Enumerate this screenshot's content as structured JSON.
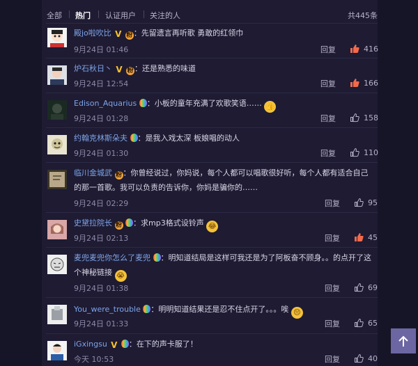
{
  "tabs": {
    "all": "全部",
    "hot": "热门",
    "verified": "认证用户",
    "following": "关注的人",
    "total": "共445条"
  },
  "reply_label": "回复",
  "comments": [
    {
      "user": "殿jo啦吹比",
      "text": "先留遗言再听歌 勇敢的红领巾",
      "time": "9月24日 01:46",
      "likes": "416",
      "liked": true
    },
    {
      "user": "炉石秋日丶",
      "text": "还是熟悉的味道",
      "time": "9月24日 12:54",
      "likes": "166",
      "liked": true
    },
    {
      "user": "Edison_Aquarius",
      "text": "小板的童年充满了欢歌笑语……",
      "time": "9月24日 01:28",
      "likes": "158",
      "liked": false
    },
    {
      "user": "约翰克林斯朵夫",
      "text": "是我入戏太深 板娘唱的动人",
      "time": "9月24日 01:30",
      "likes": "110",
      "liked": false
    },
    {
      "user": "临川金城武",
      "text": "你曾经说过，你妈说，每个人都可以唱歌很好听，每个人都有适合自己的那一首歌。我可以负责的告诉你，你妈是骗你的……",
      "time": "9月24日 02:29",
      "likes": "95",
      "liked": false
    },
    {
      "user": "史黛拉院长",
      "text": "求mp3格式设铃声",
      "time": "9月24日 02:13",
      "likes": "45",
      "liked": true
    },
    {
      "user": "麦兜麦兜你怎么了麦兜",
      "text": "明知道结局是这样可我还是为了阿板奋不顾身。。的点开了这个神秘链接",
      "time": "9月24日 01:38",
      "likes": "69",
      "liked": false
    },
    {
      "user": "You_were_trouble",
      "text": "明明知道结果还是忍不住点开了。。。唉",
      "time": "9月24日 01:33",
      "likes": "65",
      "liked": false
    },
    {
      "user": "iGxingsu",
      "text": "在下的声卡服了！",
      "time": "今天 10:53",
      "likes": "40",
      "liked": false
    }
  ],
  "colors": {
    "background": "#161427",
    "panel": "#1e1b33",
    "username": "#7ea5e8",
    "like_active": "#f26a4b",
    "like_idle": "#b7b3c9"
  },
  "icons": {
    "liked": "thumbs-up-filled-icon",
    "unliked": "thumbs-up-outline-icon",
    "scroll_top": "arrow-up-icon"
  }
}
